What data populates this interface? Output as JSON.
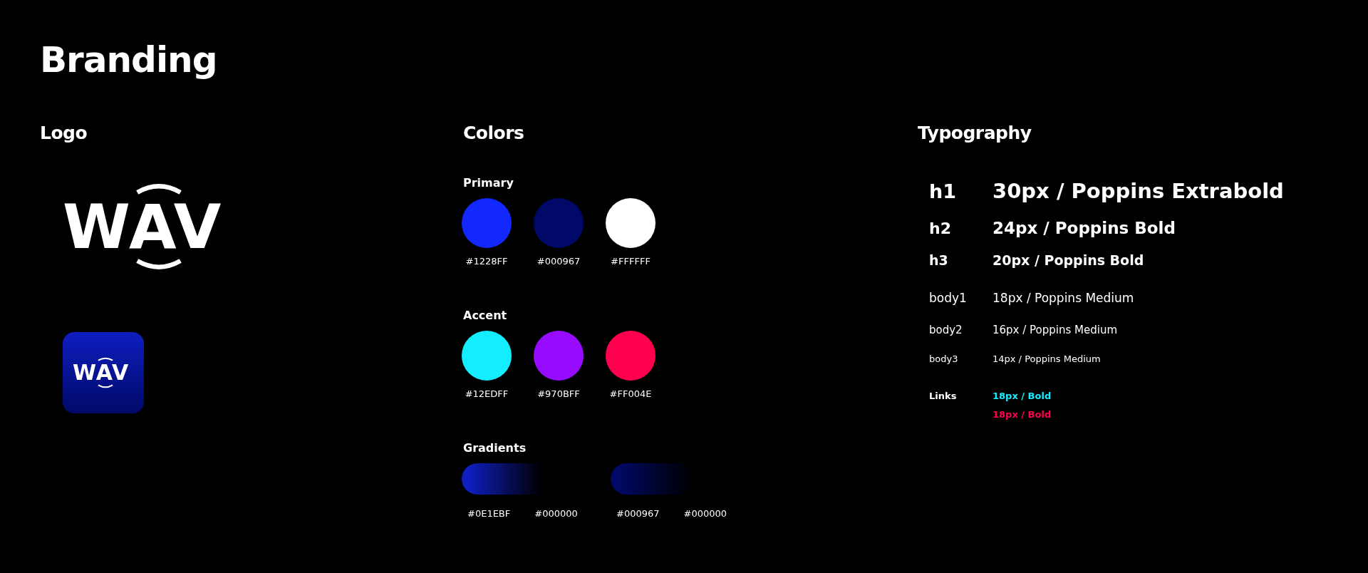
{
  "title": "Branding",
  "logo": {
    "heading": "Logo",
    "wordmark": "WAV",
    "app_icon_wordmark": "WAV"
  },
  "colors": {
    "heading": "Colors",
    "groups": [
      {
        "label": "Primary",
        "swatches": [
          {
            "color": "#1228ff",
            "hex": "#1228FF"
          },
          {
            "color": "#000967",
            "hex": "#000967"
          },
          {
            "color": "#ffffff",
            "hex": "#FFFFFF"
          }
        ]
      },
      {
        "label": "Accent",
        "swatches": [
          {
            "color": "#12edff",
            "hex": "#12EDFF"
          },
          {
            "color": "#970bff",
            "hex": "#970BFF"
          },
          {
            "color": "#ff004e",
            "hex": "#FF004E"
          }
        ]
      }
    ],
    "gradients": {
      "label": "Gradients",
      "items": [
        {
          "color": "#0e1ebf",
          "stops": [
            "#0E1EBF",
            "#000000"
          ]
        },
        {
          "color": "#000967",
          "stops": [
            "#000967",
            "#000000"
          ]
        }
      ]
    }
  },
  "typography": {
    "heading": "Typography",
    "rows": [
      {
        "kind": "h1",
        "label": "h1",
        "spec": "30px / Poppins Extrabold"
      },
      {
        "kind": "h2",
        "label": "h2",
        "spec": "24px / Poppins Bold"
      },
      {
        "kind": "h3",
        "label": "h3",
        "spec": "20px / Poppins Bold"
      },
      {
        "kind": "body1",
        "label": "body1",
        "spec": "18px / Poppins Medium"
      },
      {
        "kind": "body2",
        "label": "body2",
        "spec": "16px / Poppins Medium"
      },
      {
        "kind": "body3",
        "label": "body3",
        "spec": "14px / Poppins Medium"
      }
    ],
    "links": {
      "label": "Links",
      "items": [
        {
          "text": "18px / Bold",
          "color": "#12edff"
        },
        {
          "text": "18px / Bold",
          "color": "#ff004e"
        }
      ]
    }
  }
}
